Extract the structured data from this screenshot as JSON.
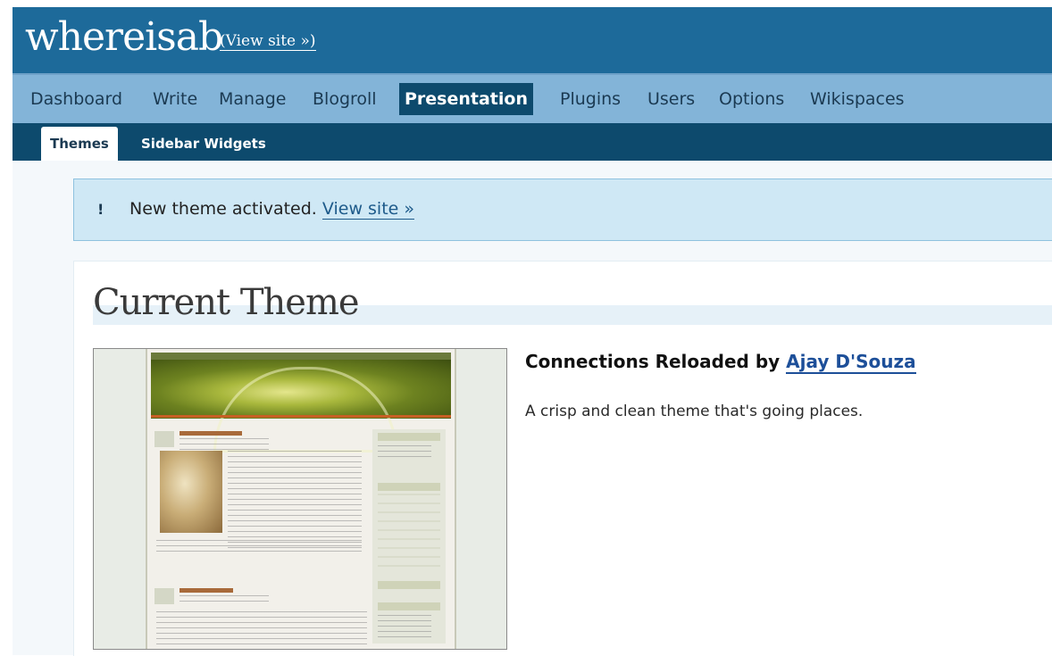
{
  "header": {
    "blog_title": "whereisab",
    "view_site": "(View site »)"
  },
  "main_nav": {
    "tabs": [
      {
        "label": "Dashboard"
      },
      {
        "label": "Write"
      },
      {
        "label": "Manage"
      },
      {
        "label": "Blogroll"
      },
      {
        "label": "Presentation",
        "active": true
      },
      {
        "label": "Plugins"
      },
      {
        "label": "Users"
      },
      {
        "label": "Options"
      },
      {
        "label": "Wikispaces"
      }
    ]
  },
  "sub_nav": {
    "tabs": [
      {
        "label": "Themes",
        "active": true
      },
      {
        "label": "Sidebar Widgets"
      }
    ]
  },
  "notice": {
    "icon": "!",
    "text": "New theme activated.",
    "link": "View site »"
  },
  "current_theme": {
    "title": "Current Theme",
    "theme_name": "Connections Reloaded",
    "by_label": "by",
    "author": "Ajay D'Souza",
    "description": "A crisp and clean theme that's going places."
  },
  "colors": {
    "header_bg": "#1d6a9a",
    "main_nav_bg": "#83b4d8",
    "active_tab_bg": "#0d4a6d",
    "notice_bg": "#cfe8f5",
    "link": "#1d4f99"
  }
}
